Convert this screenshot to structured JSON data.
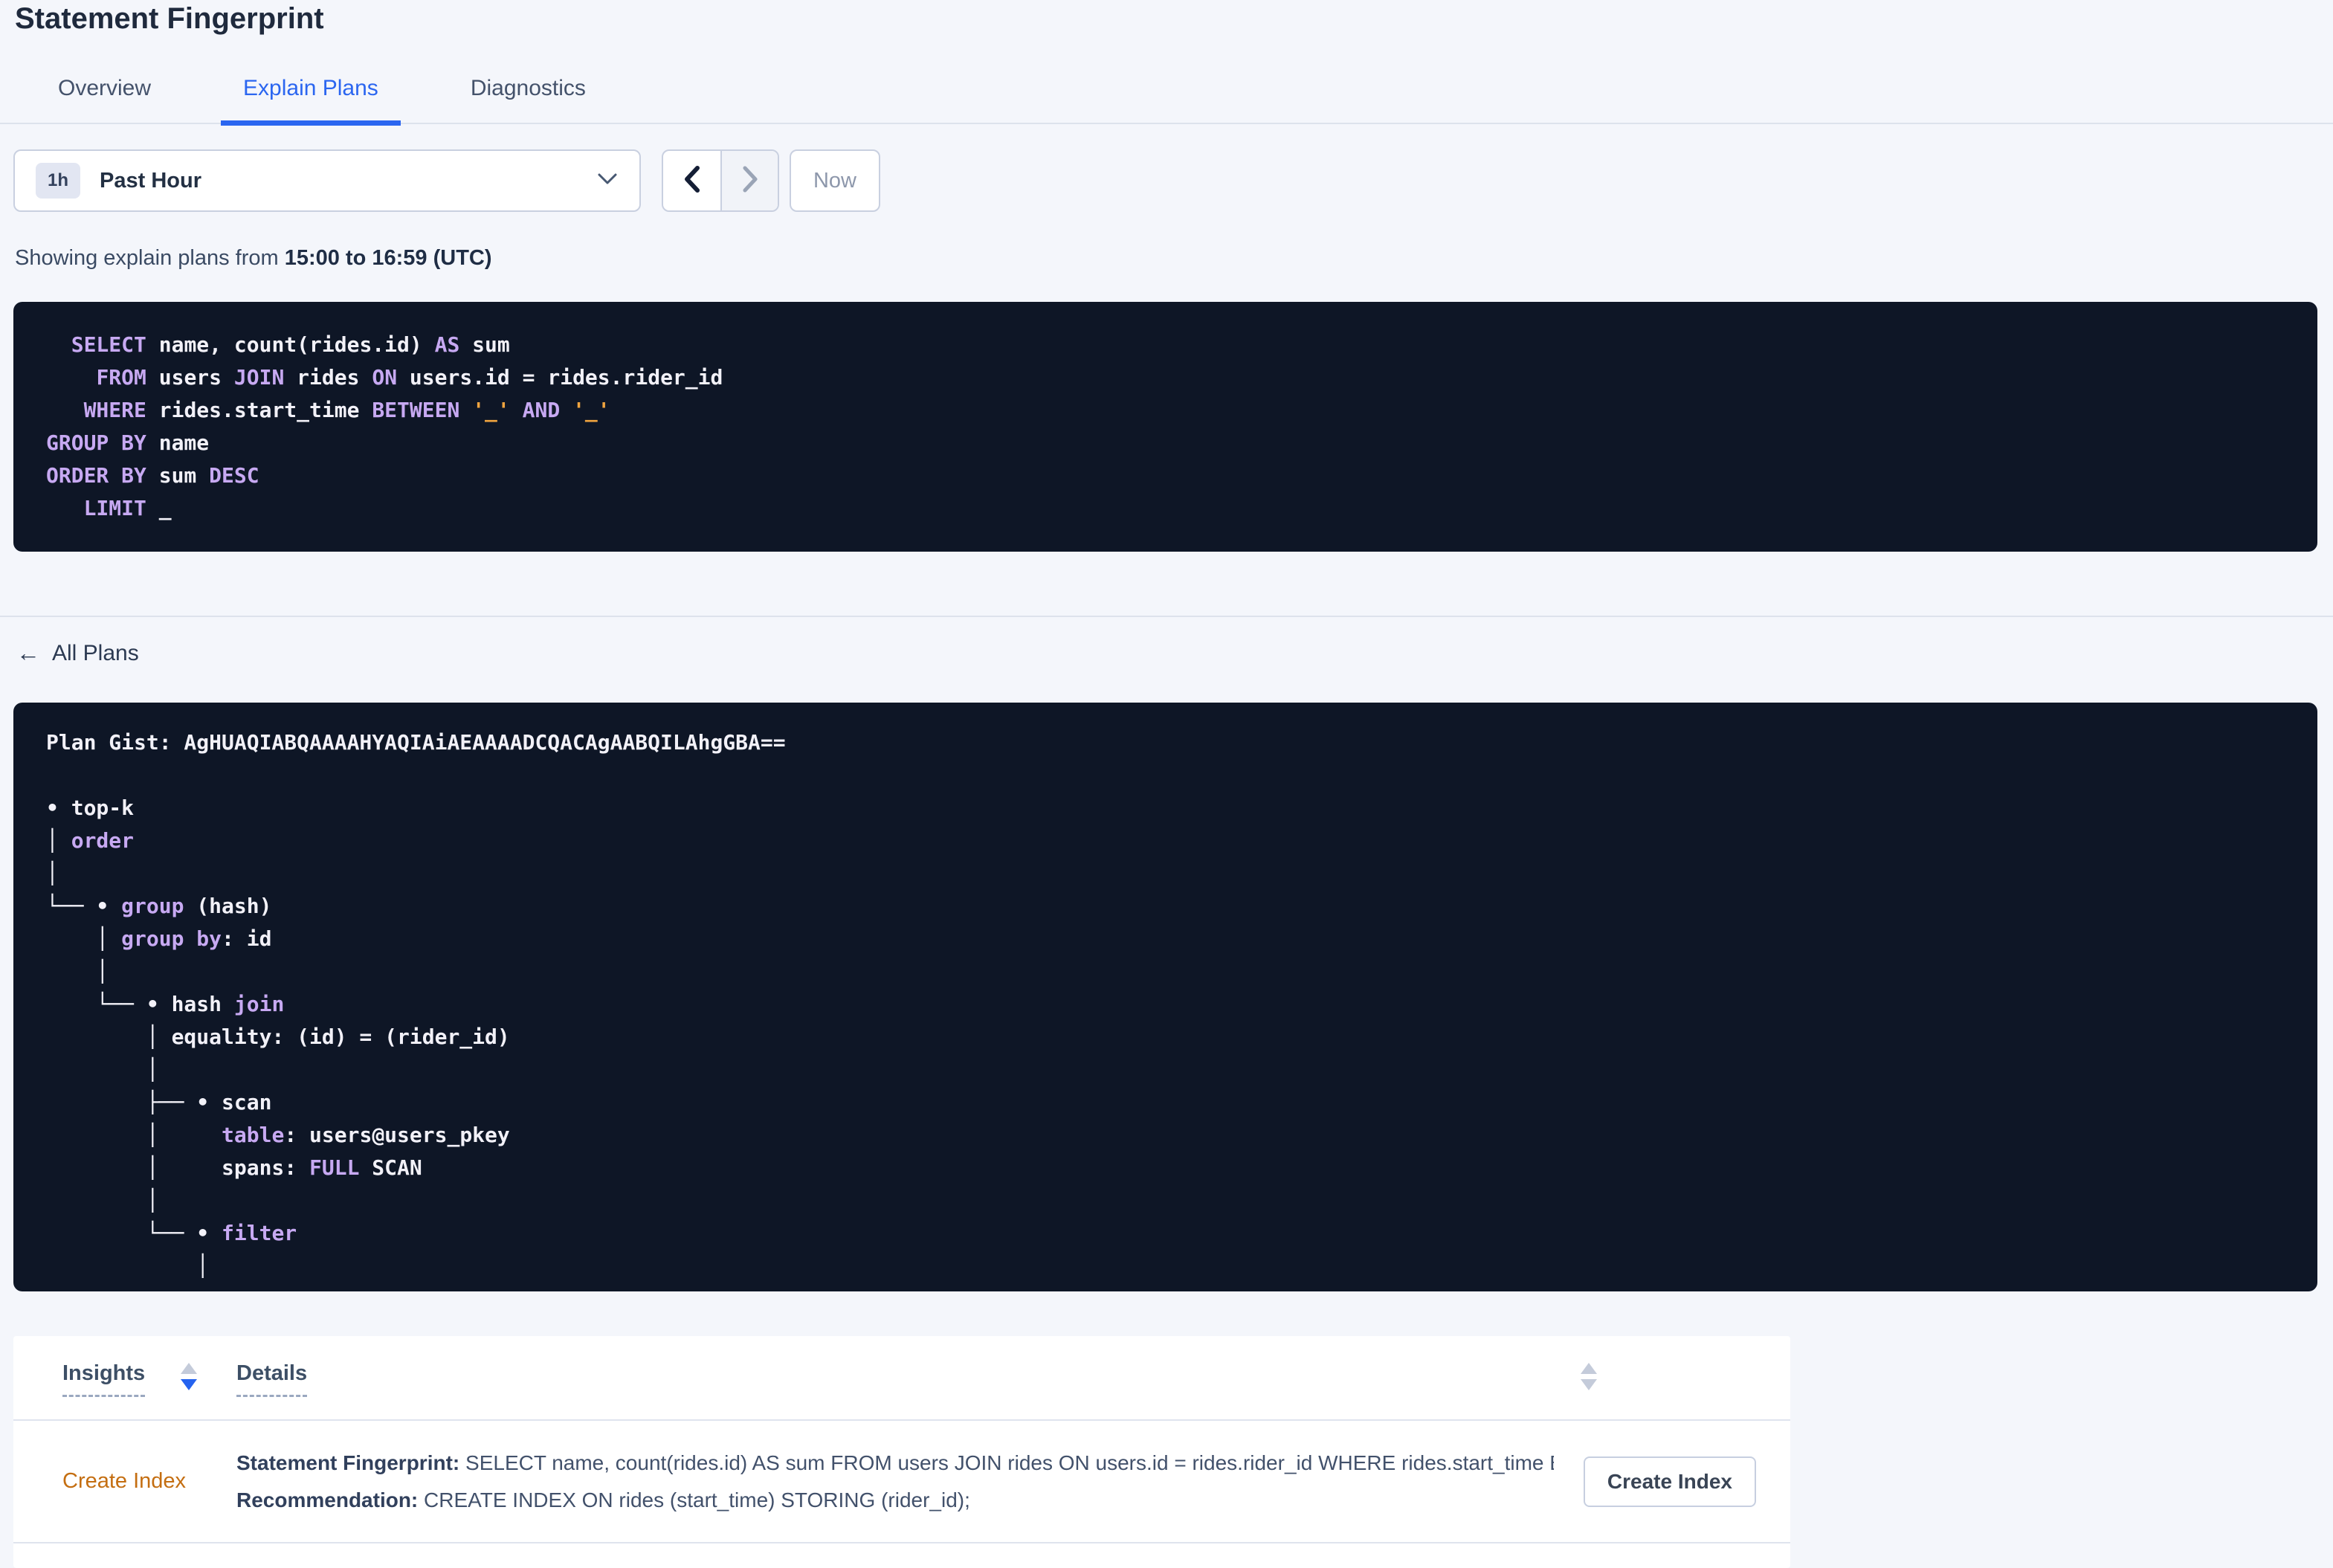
{
  "page": {
    "title": "Statement Fingerprint"
  },
  "tabs": {
    "overview": "Overview",
    "explain_plans": "Explain Plans",
    "diagnostics": "Diagnostics"
  },
  "time_picker": {
    "badge": "1h",
    "label": "Past Hour",
    "now_label": "Now"
  },
  "caption": {
    "prefix": "Showing explain plans from ",
    "range": "15:00 to 16:59 (UTC)"
  },
  "sql": {
    "lines": [
      [
        {
          "c": "p",
          "t": "  "
        },
        {
          "c": "k",
          "t": "SELECT"
        },
        {
          "c": "p",
          "t": " name, count(rides.id) "
        },
        {
          "c": "k",
          "t": "AS"
        },
        {
          "c": "p",
          "t": " sum"
        }
      ],
      [
        {
          "c": "p",
          "t": "    "
        },
        {
          "c": "k",
          "t": "FROM"
        },
        {
          "c": "p",
          "t": " users "
        },
        {
          "c": "k",
          "t": "JOIN"
        },
        {
          "c": "p",
          "t": " rides "
        },
        {
          "c": "k",
          "t": "ON"
        },
        {
          "c": "p",
          "t": " users.id = rides.rider_id"
        }
      ],
      [
        {
          "c": "p",
          "t": "   "
        },
        {
          "c": "k",
          "t": "WHERE"
        },
        {
          "c": "p",
          "t": " rides.start_time "
        },
        {
          "c": "k",
          "t": "BETWEEN"
        },
        {
          "c": "p",
          "t": " "
        },
        {
          "c": "l",
          "t": "'_'"
        },
        {
          "c": "p",
          "t": " "
        },
        {
          "c": "k",
          "t": "AND"
        },
        {
          "c": "p",
          "t": " "
        },
        {
          "c": "l",
          "t": "'_'"
        }
      ],
      [
        {
          "c": "k",
          "t": "GROUP BY"
        },
        {
          "c": "p",
          "t": " name"
        }
      ],
      [
        {
          "c": "k",
          "t": "ORDER BY"
        },
        {
          "c": "p",
          "t": " sum "
        },
        {
          "c": "k",
          "t": "DESC"
        }
      ],
      [
        {
          "c": "p",
          "t": "   "
        },
        {
          "c": "k",
          "t": "LIMIT"
        },
        {
          "c": "p",
          "t": " _"
        }
      ]
    ]
  },
  "back_link": {
    "arrow": "←",
    "label": "All Plans"
  },
  "plan": {
    "gist": "Plan Gist: AgHUAQIABQAAAAHYAQIAiAEAAAADCQACAgAABQILAhgGBA==",
    "tree_lines": [
      [
        {
          "c": "p",
          "t": "• top-k"
        }
      ],
      [
        {
          "c": "p",
          "t": "│ "
        },
        {
          "c": "k",
          "t": "order"
        }
      ],
      [
        {
          "c": "p",
          "t": "│"
        }
      ],
      [
        {
          "c": "p",
          "t": "└── • "
        },
        {
          "c": "k",
          "t": "group"
        },
        {
          "c": "p",
          "t": " (hash)"
        }
      ],
      [
        {
          "c": "p",
          "t": "    │ "
        },
        {
          "c": "k",
          "t": "group by"
        },
        {
          "c": "p",
          "t": ": id"
        }
      ],
      [
        {
          "c": "p",
          "t": "    │"
        }
      ],
      [
        {
          "c": "p",
          "t": "    └── • hash "
        },
        {
          "c": "k",
          "t": "join"
        }
      ],
      [
        {
          "c": "p",
          "t": "        │ equality: (id) = (rider_id)"
        }
      ],
      [
        {
          "c": "p",
          "t": "        │"
        }
      ],
      [
        {
          "c": "p",
          "t": "        ├── • scan"
        }
      ],
      [
        {
          "c": "p",
          "t": "        │     "
        },
        {
          "c": "k",
          "t": "table"
        },
        {
          "c": "p",
          "t": ": users@users_pkey"
        }
      ],
      [
        {
          "c": "p",
          "t": "        │     spans: "
        },
        {
          "c": "k",
          "t": "FULL"
        },
        {
          "c": "p",
          "t": " SCAN"
        }
      ],
      [
        {
          "c": "p",
          "t": "        │"
        }
      ],
      [
        {
          "c": "p",
          "t": "        └── • "
        },
        {
          "c": "k",
          "t": "filter"
        }
      ],
      [
        {
          "c": "p",
          "t": "            │"
        }
      ]
    ]
  },
  "insights_table": {
    "columns": {
      "insights": "Insights",
      "details": "Details"
    },
    "row": {
      "insight": "Create Index",
      "fingerprint_label": "Statement Fingerprint:",
      "fingerprint_text": " SELECT name, count(rides.id) AS sum FROM users JOIN rides ON users.id = rides.rider_id WHERE rides.start_time BETWEEN '_…",
      "recommendation_label": "Recommendation:",
      "recommendation_text": " CREATE INDEX ON rides (start_time) STORING (rider_id);",
      "action_button": "Create Index"
    }
  },
  "colors": {
    "accent_blue": "#2b66f0",
    "keyword_purple": "#c7a9f2",
    "literal_orange": "#f0a43f",
    "insight_link_orange": "#c46e11",
    "code_background": "#0e1626",
    "page_background": "#f4f6fb"
  }
}
